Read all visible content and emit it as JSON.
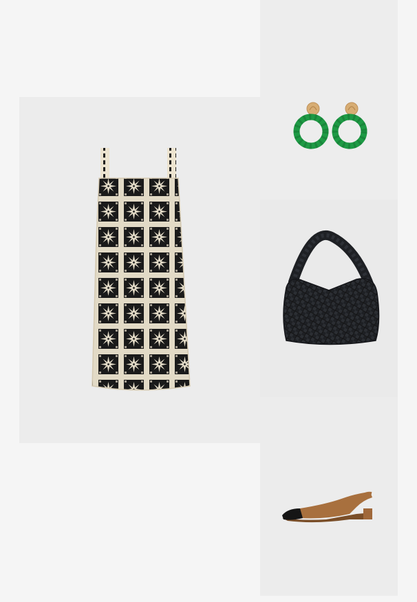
{
  "outfit": {
    "items": [
      {
        "id": "dress",
        "icon": "crochet-mini-dress"
      },
      {
        "id": "earrings",
        "icon": "green-beaded-hoop-earrings"
      },
      {
        "id": "bag",
        "icon": "black-woven-hobo-bag"
      },
      {
        "id": "shoes",
        "icon": "suede-slingback-flats"
      }
    ]
  },
  "colors": {
    "page_bg": "#f5f5f5",
    "tile_bg": "#ececec",
    "crochet_cream": "#ece3cf",
    "crochet_black": "#1c1c1c",
    "bead_green": "#1e9a45",
    "earring_gold": "#d7ad74",
    "bag_black": "#1e2024",
    "shoe_tan": "#a8703e",
    "shoe_black_toe": "#151515"
  }
}
